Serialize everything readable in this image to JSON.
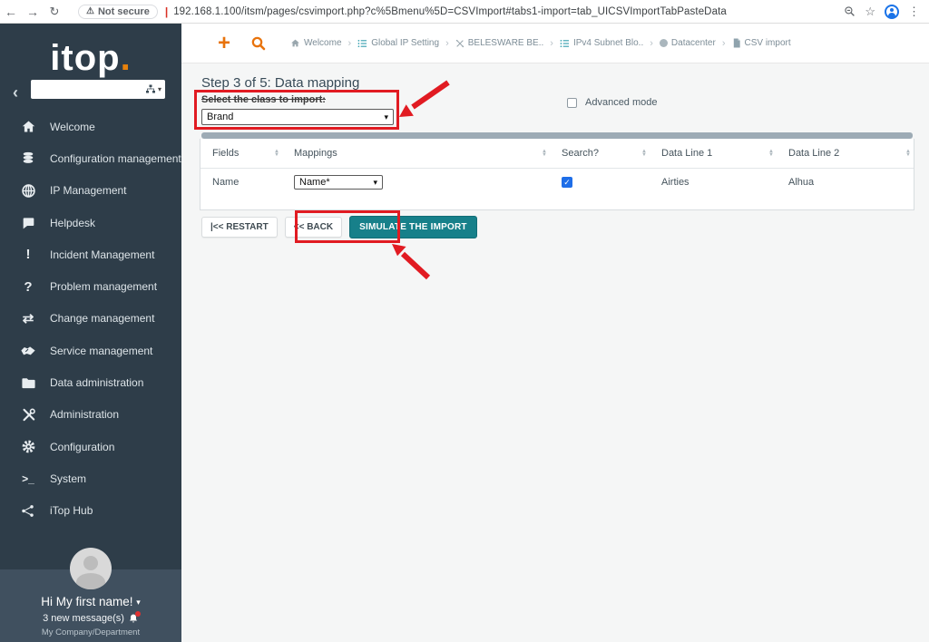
{
  "browser": {
    "security_label": "Not secure",
    "url": "192.168.1.100/itsm/pages/csvimport.php?c%5Bmenu%5D=CSVImport#tabs1-import=tab_UICSVImportTabPasteData"
  },
  "icons": {
    "back": "←",
    "forward": "→",
    "reload": "↻",
    "warning": "⚠",
    "star": "☆",
    "menu_dots": "⋮",
    "collapse_chevron": "‹",
    "caret_down": "▾",
    "crumb_separator": "›",
    "plus": "+",
    "sort_up": "▲",
    "sort_down": "▼",
    "check": "✓",
    "exclamation": "!",
    "question": "?",
    "swap_arrows": "⇄",
    "terminal": ">_"
  },
  "header": {
    "breadcrumbs": [
      {
        "icon": "home-icon",
        "label": "Welcome"
      },
      {
        "icon": "list-icon",
        "label": "Global IP Setting"
      },
      {
        "icon": "network-icon",
        "label": "BELESWARE BE.."
      },
      {
        "icon": "list-icon",
        "label": "IPv4 Subnet Blo.."
      },
      {
        "icon": "sphere-icon",
        "label": "Datacenter"
      },
      {
        "icon": "file-icon",
        "label": "CSV import"
      }
    ]
  },
  "sidebar": {
    "logo_text": "itop",
    "logo_dot": ".",
    "search_placeholder": "",
    "menu": [
      {
        "icon": "home-icon",
        "label": "Welcome"
      },
      {
        "icon": "database-icon",
        "label": "Configuration management"
      },
      {
        "icon": "globe-icon",
        "label": "IP Management"
      },
      {
        "icon": "chat-icon",
        "label": "Helpdesk"
      },
      {
        "icon": "exclamation-icon",
        "label": "Incident Management"
      },
      {
        "icon": "question-icon",
        "label": "Problem management"
      },
      {
        "icon": "swap-arrows-icon",
        "label": "Change management"
      },
      {
        "icon": "handshake-icon",
        "label": "Service management"
      },
      {
        "icon": "folder-icon",
        "label": "Data administration"
      },
      {
        "icon": "tools-icon",
        "label": "Administration"
      },
      {
        "icon": "gear-icon",
        "label": "Configuration"
      },
      {
        "icon": "terminal-icon",
        "label": "System"
      },
      {
        "icon": "share-icon",
        "label": "iTop Hub"
      }
    ],
    "user": {
      "greeting": "Hi My first name!",
      "messages": "3 new message(s)",
      "organization": "My Company/Department"
    }
  },
  "main": {
    "title": "Step 3 of 5: Data mapping",
    "class_select_label": "Select the class to import:",
    "class_select_value": "Brand",
    "advanced_mode_label": "Advanced mode",
    "table": {
      "headers": [
        "Fields",
        "Mappings",
        "Search?",
        "Data Line 1",
        "Data Line 2"
      ],
      "row": {
        "field": "Name",
        "mapping_value": "Name*",
        "search_checked": true,
        "data_line_1": "Airties",
        "data_line_2": "Alhua"
      }
    },
    "buttons": {
      "restart": "|<< RESTART",
      "back": "<< BACK",
      "simulate": "SIMULATE THE IMPORT"
    }
  },
  "colors": {
    "accent_orange": "#e8730c",
    "teal_button": "#17808a",
    "annotation_red": "#e11b22",
    "sidebar_bg": "#2e3d49",
    "sidebar_bottom_bg": "#40505f",
    "checkbox_blue": "#1e6ee8",
    "breadcrumb_teal": "#2e9bab"
  }
}
